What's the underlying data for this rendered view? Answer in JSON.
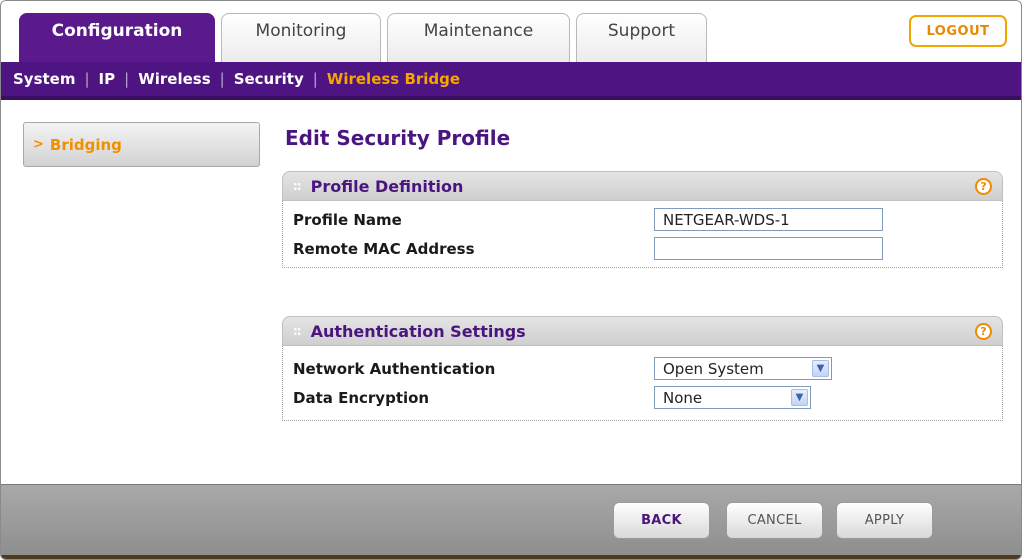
{
  "tabs": [
    {
      "label": "Configuration",
      "active": true
    },
    {
      "label": "Monitoring",
      "active": false
    },
    {
      "label": "Maintenance",
      "active": false
    },
    {
      "label": "Support",
      "active": false
    }
  ],
  "logout_label": "LOGOUT",
  "subnav": {
    "items": [
      "System",
      "IP",
      "Wireless",
      "Security",
      "Wireless Bridge"
    ],
    "current": "Wireless Bridge"
  },
  "sidebar": {
    "items": [
      {
        "label": "Bridging",
        "active": true
      }
    ]
  },
  "page_title": "Edit Security Profile",
  "profile_definition": {
    "title": "Profile Definition",
    "help": "?",
    "profile_name_label": "Profile Name",
    "profile_name_value": "NETGEAR-WDS-1",
    "remote_mac_label": "Remote MAC Address",
    "remote_mac_value": ""
  },
  "authentication_settings": {
    "title": "Authentication Settings",
    "help": "?",
    "network_auth_label": "Network Authentication",
    "network_auth_value": "Open System",
    "data_encryption_label": "Data Encryption",
    "data_encryption_value": "None"
  },
  "buttons": {
    "back": "BACK",
    "cancel": "CANCEL",
    "apply": "APPLY"
  },
  "colors": {
    "brand_purple": "#4e1482",
    "accent_orange": "#f7a600"
  }
}
